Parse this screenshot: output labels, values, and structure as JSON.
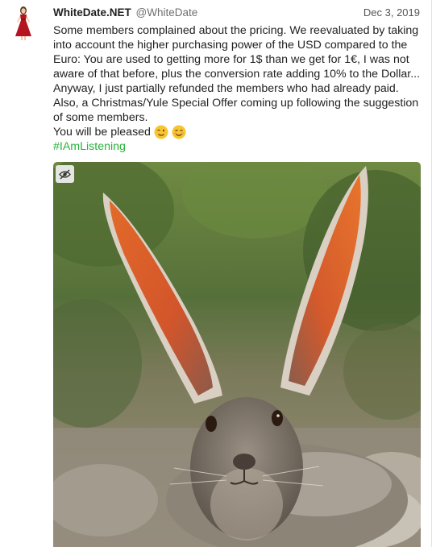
{
  "post": {
    "display_name": "WhiteDate.NET",
    "handle": "@WhiteDate",
    "date": "Dec 3, 2019",
    "body_lines": [
      "Some members complained about the pricing. We reevaluated by taking into account the higher purchasing power of the USD compared to the Euro: You are used to getting more for 1$ than we get for 1€, I was not aware of that before, plus the conversion rate adding 10% to the Dollar... Anyway, I just partially refunded the members who had already paid. Also, a Christmas/Yule Special Offer coming up following the suggestion of some members.",
      "You will be pleased"
    ],
    "hashtag": "#IAmListening",
    "emojis": [
      "winking-face",
      "smiling-face"
    ],
    "colors": {
      "hashtag": "#27b23a",
      "avatar_dress": "#b5151f"
    }
  },
  "media": {
    "icons": [
      "eye-slash-icon"
    ]
  }
}
